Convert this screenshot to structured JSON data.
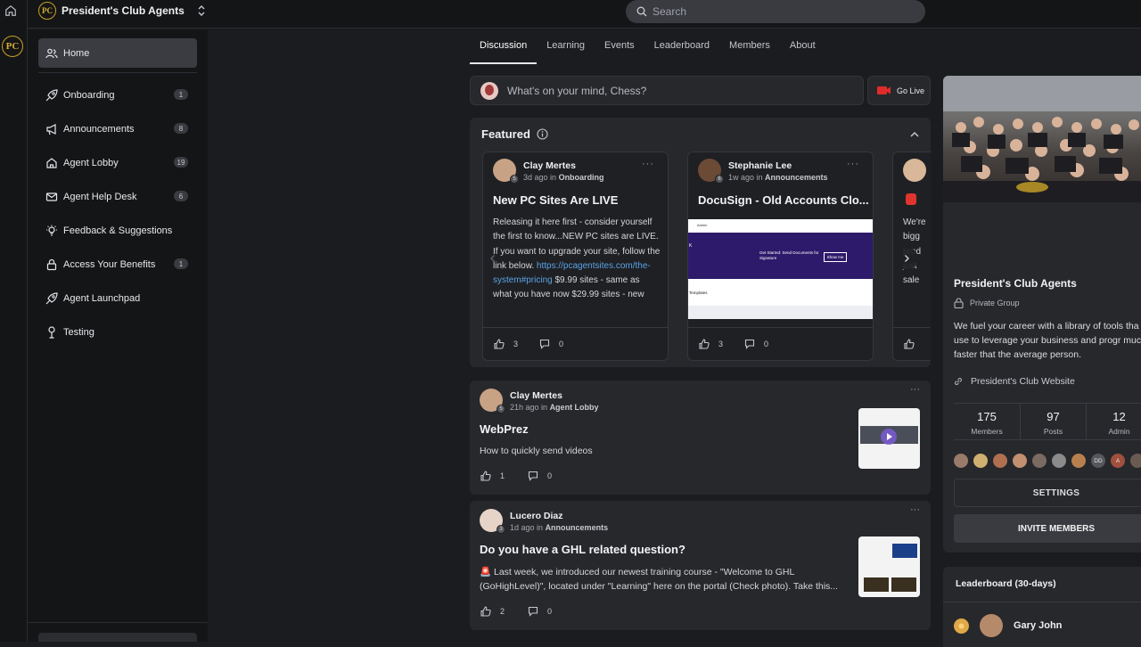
{
  "app": {
    "name": "President's Club Agents",
    "logo_text": "PC"
  },
  "search": {
    "placeholder": "Search"
  },
  "sidebar": {
    "home": {
      "label": "Home"
    },
    "items": [
      {
        "label": "Onboarding",
        "badge": "1",
        "icon": "rocket-icon"
      },
      {
        "label": "Announcements",
        "badge": "8",
        "icon": "megaphone-icon"
      },
      {
        "label": "Agent Lobby",
        "badge": "19",
        "icon": "house-icon"
      },
      {
        "label": "Agent Help Desk",
        "badge": "6",
        "icon": "mail-icon"
      },
      {
        "label": "Feedback & Suggestions",
        "badge": "",
        "icon": "lightbulb-icon"
      },
      {
        "label": "Access Your Benefits",
        "badge": "1",
        "icon": "lock-icon"
      },
      {
        "label": "Agent Launchpad",
        "badge": "",
        "icon": "rocket-icon"
      },
      {
        "label": "Testing",
        "badge": "",
        "icon": "microphone-icon"
      }
    ]
  },
  "tabs": [
    {
      "label": "Discussion",
      "active": true
    },
    {
      "label": "Learning"
    },
    {
      "label": "Events"
    },
    {
      "label": "Leaderboard"
    },
    {
      "label": "Members"
    },
    {
      "label": "About"
    }
  ],
  "composer": {
    "placeholder": "What's on your mind, Chess?",
    "go_live": "Go Live"
  },
  "featured": {
    "title": "Featured",
    "cards": [
      {
        "author": "Clay Mertes",
        "level": "5",
        "time": "3d ago in",
        "space": "Onboarding",
        "title": "New PC Sites Are LIVE",
        "body_1": "Releasing it here first - consider yourself the first to know...NEW PC sites are LIVE. If you want to upgrade your site, follow the link below. ",
        "link": "https://pcagentsites.com/the-system#pricing",
        "body_2": " $9.99 sites - same as what you have now $29.99 sites - new",
        "likes": "3",
        "comments": "0"
      },
      {
        "author": "Stephanie Lee",
        "level": "6",
        "time": "1w ago in",
        "space": "Announcements",
        "title": "DocuSign - Old Accounts Clo...",
        "image_heading": "Get Started: Send Documents for Signature",
        "image_button": "Show me",
        "image_section": "Templates",
        "image_header": "Admin",
        "likes": "3",
        "comments": "0"
      },
      {
        "body": "We're bigg prod just sale"
      }
    ]
  },
  "posts": [
    {
      "author": "Clay Mertes",
      "level": "5",
      "time": "21h ago in",
      "space": "Agent Lobby",
      "title": "WebPrez",
      "body": "How to quickly send videos",
      "likes": "1",
      "comments": "0"
    },
    {
      "author": "Lucero Diaz",
      "level": "3",
      "time": "1d ago in",
      "space": "Announcements",
      "title": "Do you have a GHL related question?",
      "body": "🚨 Last week, we introduced our newest training course - \"Welcome to GHL (GoHighLevel)\", located under \"Learning\" here on the portal (Check photo). Take this...",
      "likes": "2",
      "comments": "0"
    }
  ],
  "group": {
    "name": "President's Club Agents",
    "privacy": "Private Group",
    "description": "We fuel your career with a library of tools tha you use to leverage your business and progr much faster that the average person.",
    "website": "President's Club Website",
    "stats": [
      {
        "value": "175",
        "label": "Members"
      },
      {
        "value": "97",
        "label": "Posts"
      },
      {
        "value": "12",
        "label": "Admin"
      }
    ],
    "member_initials": [
      "DD",
      "A"
    ],
    "settings_label": "SETTINGS",
    "invite_label": "INVITE MEMBERS"
  },
  "leaderboard": {
    "title": "Leaderboard (30-days)",
    "top": "Gary John"
  }
}
